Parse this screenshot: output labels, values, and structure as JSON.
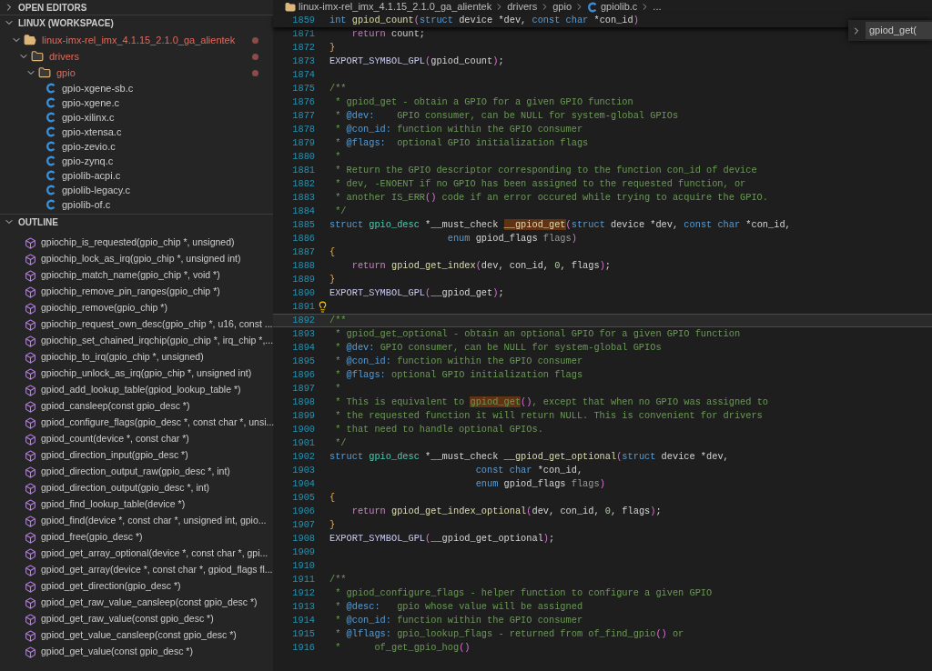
{
  "sidebar": {
    "open_editors": {
      "title": "OPEN EDITORS",
      "expanded": false
    },
    "workspace": {
      "title": "LINUX (WORKSPACE)",
      "expanded": true,
      "tree": [
        {
          "name": "linux-imx-rel_imx_4.1.15_2.1.0_ga_alientek",
          "kind": "root",
          "expanded": true,
          "modified": true,
          "children": [
            {
              "name": "drivers",
              "kind": "folder",
              "expanded": true,
              "modified": true,
              "children": [
                {
                  "name": "gpio",
                  "kind": "folder",
                  "expanded": true,
                  "modified": true,
                  "children": [
                    {
                      "name": "gpio-xgene-sb.c",
                      "kind": "c",
                      "modified": false
                    },
                    {
                      "name": "gpio-xgene.c",
                      "kind": "c",
                      "modified": false
                    },
                    {
                      "name": "gpio-xilinx.c",
                      "kind": "c",
                      "modified": false
                    },
                    {
                      "name": "gpio-xtensa.c",
                      "kind": "c",
                      "modified": false
                    },
                    {
                      "name": "gpio-zevio.c",
                      "kind": "c",
                      "modified": false
                    },
                    {
                      "name": "gpio-zynq.c",
                      "kind": "c",
                      "modified": false
                    },
                    {
                      "name": "gpiolib-acpi.c",
                      "kind": "c",
                      "modified": false
                    },
                    {
                      "name": "gpiolib-legacy.c",
                      "kind": "c",
                      "modified": false
                    },
                    {
                      "name": "gpiolib-of.c",
                      "kind": "c",
                      "modified": false
                    }
                  ]
                }
              ]
            }
          ]
        }
      ]
    },
    "outline": {
      "title": "OUTLINE",
      "expanded": true,
      "items": [
        "gpiochip_is_requested(gpio_chip *, unsigned)",
        "gpiochip_lock_as_irq(gpio_chip *, unsigned int)",
        "gpiochip_match_name(gpio_chip *, void *)",
        "gpiochip_remove_pin_ranges(gpio_chip *)",
        "gpiochip_remove(gpio_chip *)",
        "gpiochip_request_own_desc(gpio_chip *, u16, const ...",
        "gpiochip_set_chained_irqchip(gpio_chip *, irq_chip *,...",
        "gpiochip_to_irq(gpio_chip *, unsigned)",
        "gpiochip_unlock_as_irq(gpio_chip *, unsigned int)",
        "gpiod_add_lookup_table(gpiod_lookup_table *)",
        "gpiod_cansleep(const gpio_desc *)",
        "gpiod_configure_flags(gpio_desc *, const char *, unsi...",
        "gpiod_count(device *, const char *)",
        "gpiod_direction_input(gpio_desc *)",
        "gpiod_direction_output_raw(gpio_desc *, int)",
        "gpiod_direction_output(gpio_desc *, int)",
        "gpiod_find_lookup_table(device *)",
        "gpiod_find(device *, const char *, unsigned int, gpio...",
        "gpiod_free(gpio_desc *)",
        "gpiod_get_array_optional(device *, const char *, gpi...",
        "gpiod_get_array(device *, const char *, gpiod_flags fl...",
        "gpiod_get_direction(gpio_desc *)",
        "gpiod_get_raw_value_cansleep(const gpio_desc *)",
        "gpiod_get_raw_value(const gpio_desc *)",
        "gpiod_get_value_cansleep(const gpio_desc *)",
        "gpiod_get_value(const gpio_desc *)"
      ]
    }
  },
  "breadcrumb": [
    {
      "text": "linux-imx-rel_imx_4.1.15_2.1.0_ga_alientek",
      "kind": "folder"
    },
    {
      "text": "drivers",
      "kind": "plain"
    },
    {
      "text": "gpio",
      "kind": "plain"
    },
    {
      "text": "gpiolib.c",
      "kind": "c"
    },
    {
      "text": "...",
      "kind": "plain"
    }
  ],
  "find_widget": {
    "value": "gpiod_get(",
    "expanded": false
  },
  "sticky_line": {
    "number": "1859",
    "tokens": [
      {
        "kind": "kw",
        "text": "int "
      },
      {
        "kind": "fn",
        "text": "gpiod_count"
      },
      {
        "kind": "paren",
        "text": "("
      },
      {
        "kind": "kw",
        "text": "struct"
      },
      {
        "kind": "plain",
        "text": " device *dev, "
      },
      {
        "kind": "kw",
        "text": "const char"
      },
      {
        "kind": "plain",
        "text": " *con_id"
      },
      {
        "kind": "paren",
        "text": ")"
      }
    ]
  },
  "lines": [
    {
      "number": "1871",
      "current": false,
      "hint": false,
      "tokens": [
        {
          "kind": "ctrl",
          "text": "    return"
        },
        {
          "kind": "plain",
          "text": " count;"
        }
      ]
    },
    {
      "number": "1872",
      "current": false,
      "hint": false,
      "tokens": [
        {
          "kind": "brace",
          "text": "}"
        }
      ]
    },
    {
      "number": "1873",
      "current": false,
      "hint": false,
      "tokens": [
        {
          "kind": "macro",
          "text": "EXPORT_SYMBOL_GPL"
        },
        {
          "kind": "paren",
          "text": "("
        },
        {
          "kind": "plain",
          "text": "gpiod_count"
        },
        {
          "kind": "paren",
          "text": ")"
        },
        {
          "kind": "plain",
          "text": ";"
        }
      ]
    },
    {
      "number": "1874",
      "current": false,
      "hint": false
    },
    {
      "number": "1875",
      "current": false,
      "hint": false,
      "tokens": [
        {
          "kind": "comment",
          "text": "/**"
        }
      ]
    },
    {
      "number": "1876",
      "current": false,
      "hint": false,
      "tokens": [
        {
          "kind": "comment",
          "text": " * gpiod_get - obtain a GPIO for a given GPIO function"
        }
      ]
    },
    {
      "number": "1877",
      "current": false,
      "hint": false,
      "tokens": [
        {
          "kind": "comment",
          "text": " * "
        },
        {
          "kind": "tag",
          "text": "@dev:"
        },
        {
          "kind": "comment",
          "text": "    GPIO consumer, can be NULL for system-global GPIOs"
        }
      ]
    },
    {
      "number": "1878",
      "current": false,
      "hint": false,
      "tokens": [
        {
          "kind": "comment",
          "text": " * "
        },
        {
          "kind": "tag",
          "text": "@con_id:"
        },
        {
          "kind": "comment",
          "text": " function within the GPIO consumer"
        }
      ]
    },
    {
      "number": "1879",
      "current": false,
      "hint": false,
      "tokens": [
        {
          "kind": "comment",
          "text": " * "
        },
        {
          "kind": "tag",
          "text": "@flags:"
        },
        {
          "kind": "comment",
          "text": "  optional GPIO initialization flags"
        }
      ]
    },
    {
      "number": "1880",
      "current": false,
      "hint": false,
      "tokens": [
        {
          "kind": "comment",
          "text": " *"
        }
      ]
    },
    {
      "number": "1881",
      "current": false,
      "hint": false,
      "tokens": [
        {
          "kind": "comment",
          "text": " * Return the GPIO descriptor corresponding to the function con_id of device"
        }
      ]
    },
    {
      "number": "1882",
      "current": false,
      "hint": false,
      "tokens": [
        {
          "kind": "comment",
          "text": " * dev, -ENOENT if no GPIO has been assigned to the requested function, or"
        }
      ]
    },
    {
      "number": "1883",
      "current": false,
      "hint": false,
      "tokens": [
        {
          "kind": "comment",
          "text": " * another IS_ERR"
        },
        {
          "kind": "paren",
          "text": "()"
        },
        {
          "kind": "comment",
          "text": " code if an error occured while trying to acquire the GPIO."
        }
      ]
    },
    {
      "number": "1884",
      "current": false,
      "hint": false,
      "tokens": [
        {
          "kind": "comment",
          "text": " */"
        }
      ]
    },
    {
      "number": "1885",
      "current": false,
      "hint": false,
      "tokens": [
        {
          "kind": "kw",
          "text": "struct "
        },
        {
          "kind": "type",
          "text": "gpio_desc"
        },
        {
          "kind": "plain",
          "text": " *__must_check "
        },
        {
          "kind": "found",
          "text": "__gpiod_get"
        },
        {
          "kind": "paren",
          "text": "("
        },
        {
          "kind": "kw",
          "text": "struct"
        },
        {
          "kind": "plain",
          "text": " device *dev, "
        },
        {
          "kind": "kw",
          "text": "const char"
        },
        {
          "kind": "plain",
          "text": " *con_id,"
        }
      ]
    },
    {
      "number": "1886",
      "current": false,
      "hint": false,
      "tokens": [
        {
          "kind": "kw",
          "text": "                     enum"
        },
        {
          "kind": "plain",
          "text": " gpiod_flags "
        },
        {
          "kind": "param",
          "text": "flags"
        },
        {
          "kind": "paren",
          "text": ")"
        }
      ]
    },
    {
      "number": "1887",
      "current": false,
      "hint": false,
      "tokens": [
        {
          "kind": "brace",
          "text": "{"
        }
      ]
    },
    {
      "number": "1888",
      "current": false,
      "hint": false,
      "tokens": [
        {
          "kind": "ctrl",
          "text": "    return "
        },
        {
          "kind": "fn",
          "text": "gpiod_get_index"
        },
        {
          "kind": "paren",
          "text": "("
        },
        {
          "kind": "plain",
          "text": "dev, con_id, "
        },
        {
          "kind": "num",
          "text": "0"
        },
        {
          "kind": "plain",
          "text": ", flags"
        },
        {
          "kind": "paren",
          "text": ")"
        },
        {
          "kind": "plain",
          "text": ";"
        }
      ]
    },
    {
      "number": "1889",
      "current": false,
      "hint": false,
      "tokens": [
        {
          "kind": "brace",
          "text": "}"
        }
      ]
    },
    {
      "number": "1890",
      "current": false,
      "hint": false,
      "tokens": [
        {
          "kind": "macro",
          "text": "EXPORT_SYMBOL_GPL"
        },
        {
          "kind": "paren",
          "text": "("
        },
        {
          "kind": "plain",
          "text": "__gpiod_get"
        },
        {
          "kind": "paren",
          "text": ")"
        },
        {
          "kind": "plain",
          "text": ";"
        }
      ]
    },
    {
      "number": "1891",
      "current": false,
      "hint": true
    },
    {
      "number": "1892",
      "current": true,
      "hint": false,
      "tokens": [
        {
          "kind": "comment",
          "text": "/**"
        }
      ]
    },
    {
      "number": "1893",
      "current": false,
      "hint": false,
      "tokens": [
        {
          "kind": "comment",
          "text": " * gpiod_get_optional - obtain an optional GPIO for a given GPIO function"
        }
      ]
    },
    {
      "number": "1894",
      "current": false,
      "hint": false,
      "tokens": [
        {
          "kind": "comment",
          "text": " * "
        },
        {
          "kind": "tag",
          "text": "@dev:"
        },
        {
          "kind": "comment",
          "text": " GPIO consumer, can be NULL for system-global GPIOs"
        }
      ]
    },
    {
      "number": "1895",
      "current": false,
      "hint": false,
      "tokens": [
        {
          "kind": "comment",
          "text": " * "
        },
        {
          "kind": "tag",
          "text": "@con_id:"
        },
        {
          "kind": "comment",
          "text": " function within the GPIO consumer"
        }
      ]
    },
    {
      "number": "1896",
      "current": false,
      "hint": false,
      "tokens": [
        {
          "kind": "comment",
          "text": " * "
        },
        {
          "kind": "tag",
          "text": "@flags:"
        },
        {
          "kind": "comment",
          "text": " optional GPIO initialization flags"
        }
      ]
    },
    {
      "number": "1897",
      "current": false,
      "hint": false,
      "tokens": [
        {
          "kind": "comment",
          "text": " *"
        }
      ]
    },
    {
      "number": "1898",
      "current": false,
      "hint": false,
      "tokens": [
        {
          "kind": "comment",
          "text": " * This is equivalent to "
        },
        {
          "kind": "foundcomment",
          "text": "gpiod_get"
        },
        {
          "kind": "paren",
          "text": "()"
        },
        {
          "kind": "comment",
          "text": ", except that when no GPIO was assigned to"
        }
      ]
    },
    {
      "number": "1899",
      "current": false,
      "hint": false,
      "tokens": [
        {
          "kind": "comment",
          "text": " * the requested function it will return NULL. This is convenient for drivers"
        }
      ]
    },
    {
      "number": "1900",
      "current": false,
      "hint": false,
      "tokens": [
        {
          "kind": "comment",
          "text": " * that need to handle optional GPIOs."
        }
      ]
    },
    {
      "number": "1901",
      "current": false,
      "hint": false,
      "tokens": [
        {
          "kind": "comment",
          "text": " */"
        }
      ]
    },
    {
      "number": "1902",
      "current": false,
      "hint": false,
      "tokens": [
        {
          "kind": "kw",
          "text": "struct "
        },
        {
          "kind": "type",
          "text": "gpio_desc"
        },
        {
          "kind": "plain",
          "text": " *__must_check "
        },
        {
          "kind": "fn",
          "text": "__gpiod_get_optional"
        },
        {
          "kind": "paren",
          "text": "("
        },
        {
          "kind": "kw",
          "text": "struct"
        },
        {
          "kind": "plain",
          "text": " device *dev,"
        }
      ]
    },
    {
      "number": "1903",
      "current": false,
      "hint": false,
      "tokens": [
        {
          "kind": "kw",
          "text": "                          const char"
        },
        {
          "kind": "plain",
          "text": " *con_id,"
        }
      ]
    },
    {
      "number": "1904",
      "current": false,
      "hint": false,
      "tokens": [
        {
          "kind": "kw",
          "text": "                          enum"
        },
        {
          "kind": "plain",
          "text": " gpiod_flags "
        },
        {
          "kind": "param",
          "text": "flags"
        },
        {
          "kind": "paren",
          "text": ")"
        }
      ]
    },
    {
      "number": "1905",
      "current": false,
      "hint": false,
      "tokens": [
        {
          "kind": "brace",
          "text": "{"
        }
      ]
    },
    {
      "number": "1906",
      "current": false,
      "hint": false,
      "tokens": [
        {
          "kind": "ctrl",
          "text": "    return "
        },
        {
          "kind": "fn",
          "text": "gpiod_get_index_optional"
        },
        {
          "kind": "paren",
          "text": "("
        },
        {
          "kind": "plain",
          "text": "dev, con_id, "
        },
        {
          "kind": "num",
          "text": "0"
        },
        {
          "kind": "plain",
          "text": ", flags"
        },
        {
          "kind": "paren",
          "text": ")"
        },
        {
          "kind": "plain",
          "text": ";"
        }
      ]
    },
    {
      "number": "1907",
      "current": false,
      "hint": false,
      "tokens": [
        {
          "kind": "brace",
          "text": "}"
        }
      ]
    },
    {
      "number": "1908",
      "current": false,
      "hint": false,
      "tokens": [
        {
          "kind": "macro",
          "text": "EXPORT_SYMBOL_GPL"
        },
        {
          "kind": "paren",
          "text": "("
        },
        {
          "kind": "plain",
          "text": "__gpiod_get_optional"
        },
        {
          "kind": "paren",
          "text": ")"
        },
        {
          "kind": "plain",
          "text": ";"
        }
      ]
    },
    {
      "number": "1909",
      "current": false,
      "hint": false
    },
    {
      "number": "1910",
      "current": false,
      "hint": false
    },
    {
      "number": "1911",
      "current": false,
      "hint": false,
      "tokens": [
        {
          "kind": "comment",
          "text": "/**"
        }
      ]
    },
    {
      "number": "1912",
      "current": false,
      "hint": false,
      "tokens": [
        {
          "kind": "comment",
          "text": " * gpiod_configure_flags - helper function to configure a given GPIO"
        }
      ]
    },
    {
      "number": "1913",
      "current": false,
      "hint": false,
      "tokens": [
        {
          "kind": "comment",
          "text": " * "
        },
        {
          "kind": "tag",
          "text": "@desc:"
        },
        {
          "kind": "comment",
          "text": "   gpio whose value will be assigned"
        }
      ]
    },
    {
      "number": "1914",
      "current": false,
      "hint": false,
      "tokens": [
        {
          "kind": "comment",
          "text": " * "
        },
        {
          "kind": "tag",
          "text": "@con_id:"
        },
        {
          "kind": "comment",
          "text": " function within the GPIO consumer"
        }
      ]
    },
    {
      "number": "1915",
      "current": false,
      "hint": false,
      "tokens": [
        {
          "kind": "comment",
          "text": " * "
        },
        {
          "kind": "tag",
          "text": "@lflags:"
        },
        {
          "kind": "comment",
          "text": " gpio_lookup_flags - returned from of_find_gpio"
        },
        {
          "kind": "paren",
          "text": "()"
        },
        {
          "kind": "comment",
          "text": " or"
        }
      ]
    },
    {
      "number": "1916",
      "current": false,
      "hint": false,
      "tokens": [
        {
          "kind": "comment",
          "text": " *      of_get_gpio_hog"
        },
        {
          "kind": "paren",
          "text": "()"
        }
      ]
    }
  ]
}
